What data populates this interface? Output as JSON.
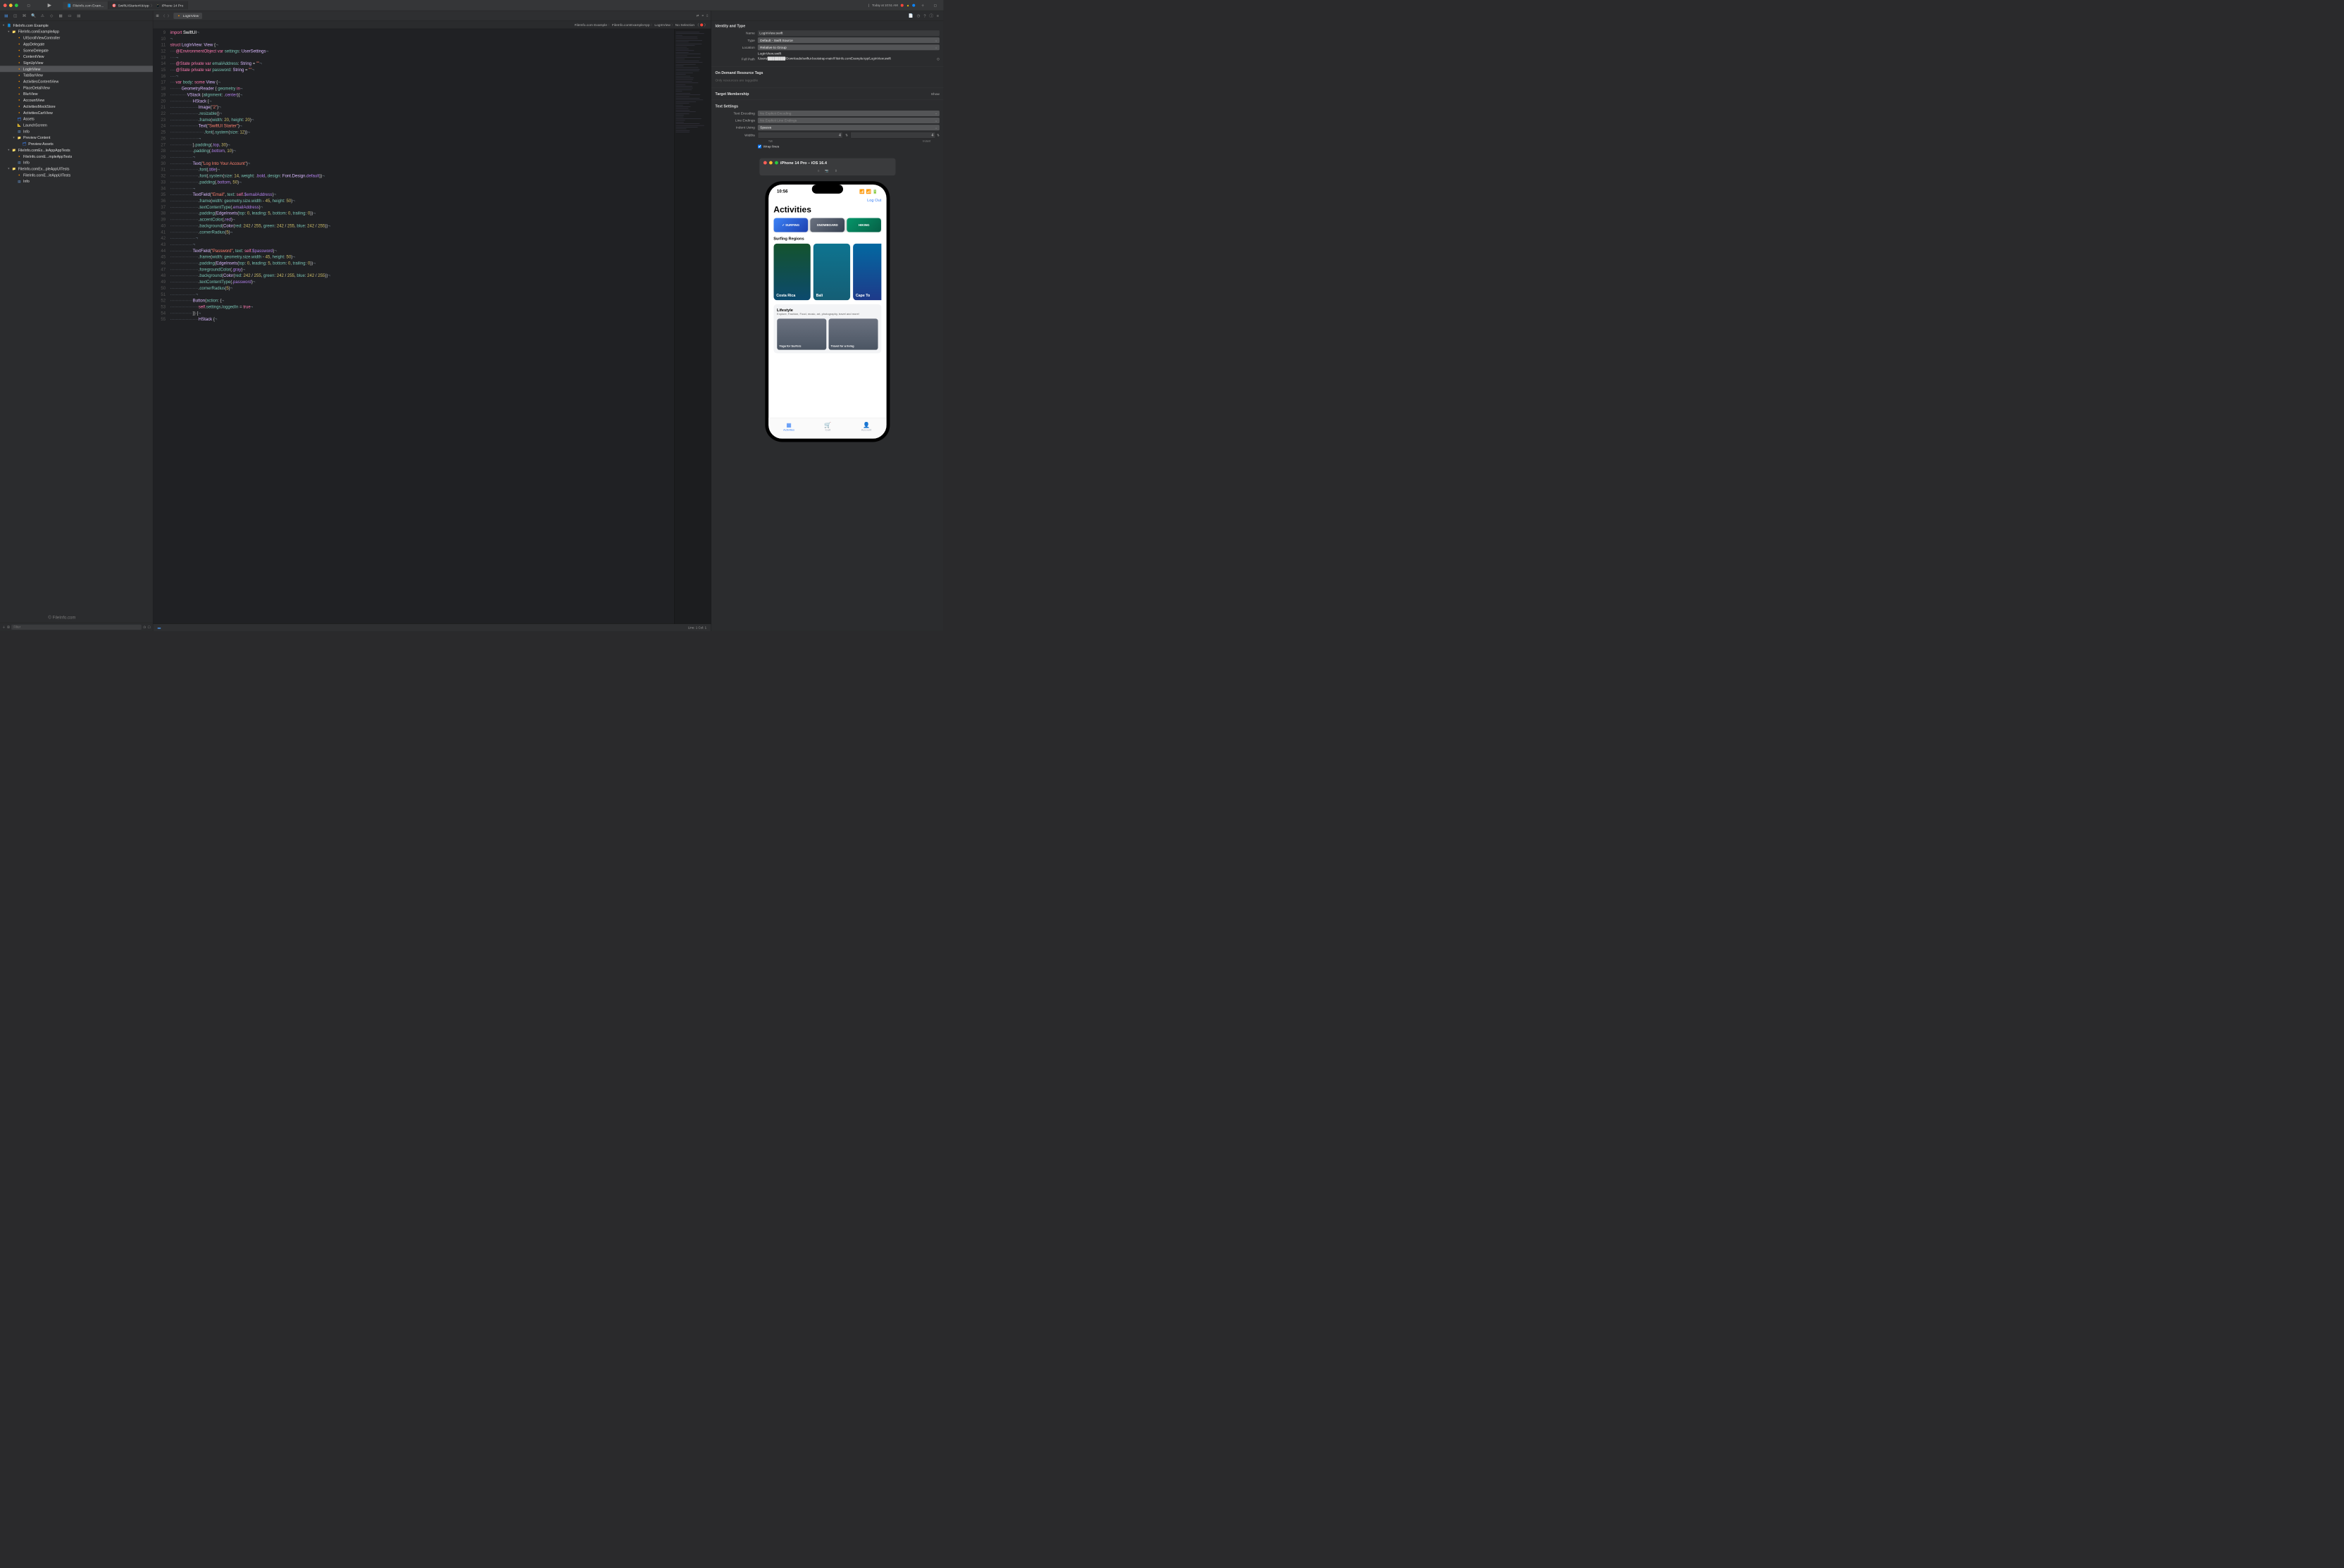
{
  "titlebar": {
    "project_tab": "FileInfo.com Exam...",
    "scheme": "SwiftUIStarterKitApp",
    "device": "iPhone 14 Pro",
    "status": "Today at 10:51 AM"
  },
  "navigator": {
    "project_name": "FileInfo.com Example",
    "nodes": [
      {
        "label": "FileInfo.com Example",
        "type": "proj",
        "level": 0,
        "open": true
      },
      {
        "label": "FileInfo.comExampleApp",
        "type": "folder",
        "level": 1,
        "open": true
      },
      {
        "label": "UIScrollViewController",
        "type": "swift",
        "level": 2
      },
      {
        "label": "AppDelegate",
        "type": "swift",
        "level": 2
      },
      {
        "label": "SceneDelegate",
        "type": "swift",
        "level": 2
      },
      {
        "label": "ContentView",
        "type": "swift",
        "level": 2
      },
      {
        "label": "SignUpView",
        "type": "swift",
        "level": 2
      },
      {
        "label": "LogInView",
        "type": "swift",
        "level": 2,
        "selected": true
      },
      {
        "label": "TabBarView",
        "type": "swift",
        "level": 2
      },
      {
        "label": "ActivitiesContentView",
        "type": "swift",
        "level": 2
      },
      {
        "label": "PlaceDetailView",
        "type": "swift",
        "level": 2
      },
      {
        "label": "BlurView",
        "type": "swift",
        "level": 2
      },
      {
        "label": "AccountView",
        "type": "swift",
        "level": 2
      },
      {
        "label": "ActivitiesMockStore",
        "type": "swift",
        "level": 2
      },
      {
        "label": "ActivitiesCartView",
        "type": "swift",
        "level": 2
      },
      {
        "label": "Assets",
        "type": "assets",
        "level": 2
      },
      {
        "label": "LaunchScreen",
        "type": "storyboard",
        "level": 2
      },
      {
        "label": "Info",
        "type": "plist",
        "level": 2
      },
      {
        "label": "Preview Content",
        "type": "folder",
        "level": 2,
        "open": true
      },
      {
        "label": "Preview Assets",
        "type": "assets",
        "level": 3
      },
      {
        "label": "FileInfo.comEx...leAppAppTests",
        "type": "folder",
        "level": 1,
        "open": true
      },
      {
        "label": "FileInfo.comE...mpleAppTests",
        "type": "swift",
        "level": 2
      },
      {
        "label": "Info",
        "type": "plist",
        "level": 2
      },
      {
        "label": "FileInfo.comEx...pleAppUITests",
        "type": "folder",
        "level": 1,
        "open": true
      },
      {
        "label": "FileInfo.comE...leAppUITests",
        "type": "swift",
        "level": 2
      },
      {
        "label": "Info",
        "type": "plist",
        "level": 2
      }
    ],
    "filter_placeholder": "Filter"
  },
  "jumpbar": {
    "active_tab": "LogInView"
  },
  "breadcrumb": [
    "FileInfo.com Example",
    "FileInfo.comExampleApp",
    "LogInView",
    "No Selection"
  ],
  "statusbar_text": "Line: 1  Col: 1",
  "code_lines": [
    {
      "n": 9,
      "html": "<span class='k'>import</span> <span class='w'>SwiftUI</span><span class='dim'>¬</span>"
    },
    {
      "n": 10,
      "html": "<span class='dim'>¬</span>"
    },
    {
      "n": 11,
      "html": "<span class='k'>struct</span> <span class='t'>LogInView</span>: <span class='t'>View</span> {<span class='dim'>¬</span>"
    },
    {
      "n": 12,
      "html": "<span class='dim'>····</span><span class='k'>@EnvironmentObject</span> <span class='k'>var</span> <span class='i'>settings</span>: <span class='t'>UserSettings</span><span class='dim'>¬</span>"
    },
    {
      "n": 13,
      "html": "<span class='dim'>····¬</span>"
    },
    {
      "n": 14,
      "html": "<span class='dim'>····</span><span class='k'>@State</span> <span class='k'>private</span> <span class='k'>var</span> <span class='i'>emailAddress</span>: <span class='t'>String</span> = <span class='s'>\"\"</span><span class='dim'>¬</span>"
    },
    {
      "n": 15,
      "html": "<span class='dim'>····</span><span class='k'>@State</span> <span class='k'>private</span> <span class='k'>var</span> <span class='i'>password</span>: <span class='t'>String</span> = <span class='s'>\"\"</span><span class='dim'>¬</span>"
    },
    {
      "n": 16,
      "html": "<span class='dim'>····¬</span>"
    },
    {
      "n": 17,
      "html": "<span class='dim'>····</span><span class='k'>var</span> <span class='i'>body</span>: <span class='k'>some</span> <span class='t'>View</span> {<span class='dim'>¬</span>"
    },
    {
      "n": 18,
      "html": "<span class='dim'>········</span><span class='t'>GeometryReader</span> { <span class='i'>geometry</span> <span class='k'>in</span><span class='dim'>¬</span>"
    },
    {
      "n": 19,
      "html": "<span class='dim'>············</span><span class='t'>VStack</span> (<span class='i'>alignment</span>: .<span class='p'>center</span>){<span class='dim'>¬</span>"
    },
    {
      "n": 20,
      "html": "<span class='dim'>················</span><span class='t'>HStack</span> {<span class='dim'>¬</span>"
    },
    {
      "n": 21,
      "html": "<span class='dim'>····················</span><span class='t'>Image</span>(<span class='s'>\"2\"</span>)<span class='dim'>¬</span>"
    },
    {
      "n": 22,
      "html": "<span class='dim'>····················</span>.<span class='i'>resizable</span>()<span class='dim'>¬</span>"
    },
    {
      "n": 23,
      "html": "<span class='dim'>····················</span>.<span class='i'>frame</span>(<span class='i'>width</span>: <span class='n'>20</span>, <span class='i'>height</span>: <span class='n'>20</span>)<span class='dim'>¬</span>"
    },
    {
      "n": 24,
      "html": "<span class='dim'>····················</span><span class='t'>Text</span>(<span class='s'>\"SwiftUI Starter\"</span>)<span class='dim'>¬</span>"
    },
    {
      "n": 25,
      "html": "<span class='dim'>························</span>.<span class='i'>font</span>(.<span class='i'>system</span>(<span class='i'>size</span>: <span class='n'>12</span>))<span class='dim'>¬</span>"
    },
    {
      "n": 26,
      "html": "<span class='dim'>····················¬</span>"
    },
    {
      "n": 27,
      "html": "<span class='dim'>················</span>}.<span class='i'>padding</span>(.<span class='p'>top</span>, <span class='n'>30</span>)<span class='dim'>¬</span>"
    },
    {
      "n": 28,
      "html": "<span class='dim'>················</span>.<span class='i'>padding</span>(.<span class='p'>bottom</span>, <span class='n'>10</span>)<span class='dim'>¬</span>"
    },
    {
      "n": 29,
      "html": "<span class='dim'>················¬</span>"
    },
    {
      "n": 30,
      "html": "<span class='dim'>················</span><span class='t'>Text</span>(<span class='s'>\"Log Into Your Account\"</span>)<span class='dim'>¬</span>"
    },
    {
      "n": 31,
      "html": "<span class='dim'>····················</span>.<span class='i'>font</span>(.<span class='p'>title</span>)<span class='dim'>¬</span>"
    },
    {
      "n": 32,
      "html": "<span class='dim'>····················</span>.<span class='i'>font</span>(.<span class='i'>system</span>(<span class='i'>size</span>: <span class='n'>14</span>, <span class='i'>weight</span>: .<span class='p'>bold</span>, <span class='i'>design</span>: <span class='t'>Font</span>.<span class='t'>Design</span>.<span class='p'>default</span>))<span class='dim'>¬</span>"
    },
    {
      "n": 33,
      "html": "<span class='dim'>····················</span>.<span class='i'>padding</span>(.<span class='p'>bottom</span>, <span class='n'>50</span>)<span class='dim'>¬</span>"
    },
    {
      "n": 34,
      "html": "<span class='dim'>················¬</span>"
    },
    {
      "n": 35,
      "html": "<span class='dim'>················</span><span class='t'>TextField</span>(<span class='s'>\"Email\"</span>, <span class='i'>text</span>: <span class='k'>self</span>.<span class='p'>$emailAddress</span>)<span class='dim'>¬</span>"
    },
    {
      "n": 36,
      "html": "<span class='dim'>····················</span>.<span class='i'>frame</span>(<span class='i'>width</span>: <span class='i'>geometry</span>.<span class='i'>size</span>.<span class='i'>width</span> - <span class='n'>45</span>, <span class='i'>height</span>: <span class='n'>50</span>)<span class='dim'>¬</span>"
    },
    {
      "n": 37,
      "html": "<span class='dim'>····················</span>.<span class='i'>textContentType</span>(.<span class='p'>emailAddress</span>)<span class='dim'>¬</span>"
    },
    {
      "n": 38,
      "html": "<span class='dim'>····················</span>.<span class='i'>padding</span>(<span class='t'>EdgeInsets</span>(<span class='i'>top</span>: <span class='n'>0</span>, <span class='i'>leading</span>: <span class='n'>5</span>, <span class='i'>bottom</span>: <span class='n'>0</span>, <span class='i'>trailing</span>: <span class='n'>0</span>))<span class='dim'>¬</span>"
    },
    {
      "n": 39,
      "html": "<span class='dim'>····················</span>.<span class='i'>accentColor</span>(.<span class='p'>red</span>)<span class='dim'>¬</span>"
    },
    {
      "n": 40,
      "html": "<span class='dim'>····················</span>.<span class='i'>background</span>(<span class='t'>Color</span>(<span class='i'>red</span>: <span class='n'>242</span> / <span class='n'>255</span>, <span class='i'>green</span>: <span class='n'>242</span> / <span class='n'>255</span>, <span class='i'>blue</span>: <span class='n'>242</span> / <span class='n'>255</span>))<span class='dim'>¬</span>"
    },
    {
      "n": 41,
      "html": "<span class='dim'>····················</span>.<span class='i'>cornerRadius</span>(<span class='n'>5</span>)<span class='dim'>¬</span>"
    },
    {
      "n": 42,
      "html": "<span class='dim'>··················¬</span>"
    },
    {
      "n": 43,
      "html": "<span class='dim'>················¬</span>"
    },
    {
      "n": 44,
      "html": "<span class='dim'>················</span><span class='t'>TextField</span>(<span class='s'>\"Password\"</span>, <span class='i'>text</span>: <span class='k'>self</span>.<span class='p'>$password</span>)<span class='dim'>¬</span>"
    },
    {
      "n": 45,
      "html": "<span class='dim'>····················</span>.<span class='i'>frame</span>(<span class='i'>width</span>: <span class='i'>geometry</span>.<span class='i'>size</span>.<span class='i'>width</span> - <span class='n'>45</span>, <span class='i'>height</span>: <span class='n'>50</span>)<span class='dim'>¬</span>"
    },
    {
      "n": 46,
      "html": "<span class='dim'>····················</span>.<span class='i'>padding</span>(<span class='t'>EdgeInsets</span>(<span class='i'>top</span>: <span class='n'>0</span>, <span class='i'>leading</span>: <span class='n'>5</span>, <span class='i'>bottom</span>: <span class='n'>0</span>, <span class='i'>trailing</span>: <span class='n'>0</span>))<span class='dim'>¬</span>"
    },
    {
      "n": 47,
      "html": "<span class='dim'>····················</span>.<span class='i'>foregroundColor</span>(.<span class='p'>gray</span>)<span class='dim'>¬</span>"
    },
    {
      "n": 48,
      "html": "<span class='dim'>····················</span>.<span class='i'>background</span>(<span class='t'>Color</span>(<span class='i'>red</span>: <span class='n'>242</span> / <span class='n'>255</span>, <span class='i'>green</span>: <span class='n'>242</span> / <span class='n'>255</span>, <span class='i'>blue</span>: <span class='n'>242</span> / <span class='n'>255</span>))<span class='dim'>¬</span>"
    },
    {
      "n": 49,
      "html": "<span class='dim'>····················</span>.<span class='i'>textContentType</span>(.<span class='p'>password</span>)<span class='dim'>¬</span>"
    },
    {
      "n": 50,
      "html": "<span class='dim'>····················</span>.<span class='i'>cornerRadius</span>(<span class='n'>5</span>)<span class='dim'>¬</span>"
    },
    {
      "n": 51,
      "html": "<span class='dim'>··················¬</span>"
    },
    {
      "n": 52,
      "html": "<span class='dim'>················</span><span class='t'>Button</span>(<span class='i'>action</span>: {<span class='dim'>¬</span>"
    },
    {
      "n": 53,
      "html": "<span class='dim'>····················</span><span class='k'>self</span>.<span class='i'>settings</span>.<span class='i'>loggedIn</span> = <span class='k'>true</span><span class='dim'>¬</span>"
    },
    {
      "n": 54,
      "html": "<span class='dim'>················</span>}) {<span class='dim'>¬</span>"
    },
    {
      "n": 55,
      "html": "<span class='dim'>····················</span><span class='t'>HStack</span> {<span class='dim'>¬</span>"
    }
  ],
  "inspector": {
    "identity_title": "Identity and Type",
    "name_label": "Name",
    "name": "LogInView.swift",
    "type_label": "Type",
    "type": "Default - Swift Source",
    "location_label": "Location",
    "location": "Relative to Group",
    "location_file": "LogInView.swift",
    "fullpath_label": "Full Path",
    "fullpath": "/Users/████████/Downloads/swiftui-bootstrap-main/FileInfo.comExampleApp/LogInView.swift",
    "ondemand_title": "On Demand Resource Tags",
    "ondemand_placeholder": "Only resources are taggable",
    "target_title": "Target Membership",
    "target_show": "Show",
    "text_title": "Text Settings",
    "enc_label": "Text Encoding",
    "enc": "No Explicit Encoding",
    "le_label": "Line Endings",
    "le": "No Explicit Line Endings",
    "indent_label": "Indent Using",
    "indent": "Spaces",
    "widths_label": "Widths",
    "tab_val": "4",
    "indent_val": "4",
    "tab_caption": "Tab",
    "indent_caption": "Indent",
    "wrap_label": "Wrap lines"
  },
  "simulator": {
    "title": "iPhone 14 Pro – iOS 16.4",
    "time": "10:56",
    "logout": "Log Out",
    "heading": "Activities",
    "chips": [
      "✓ SURFING",
      "SNOWBOARD",
      "HIKING"
    ],
    "subheading": "Surfing Regions",
    "regions": [
      "Costa Rica",
      "Bali",
      "Cape To"
    ],
    "lifestyle_title": "Lifestyle",
    "lifestyle_sub": "Explore, Fashion, Food, music, art, photography, travel and more!",
    "cards": [
      "Yoga for Surfers",
      "Travel for a living"
    ],
    "tabs": [
      {
        "label": "Activities",
        "active": true
      },
      {
        "label": "Cart"
      },
      {
        "label": "Account"
      }
    ]
  },
  "watermark": "© FileInfo.com"
}
